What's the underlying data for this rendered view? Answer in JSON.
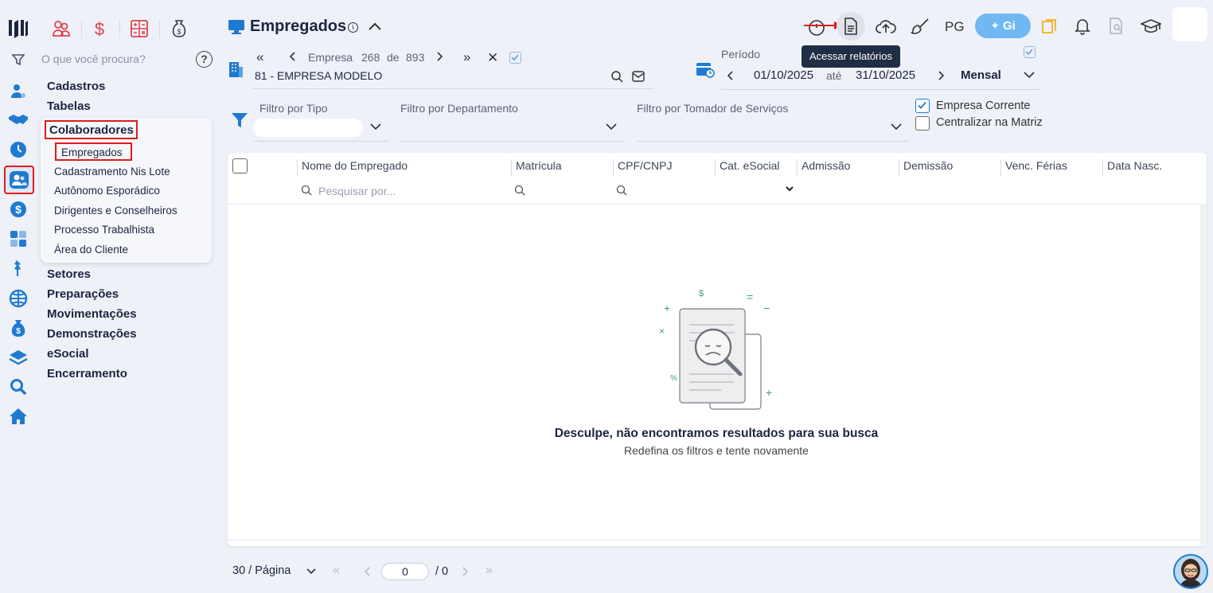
{
  "rail": {
    "icons": [
      "logo-icon",
      "filter-icon",
      "user-gear-icon",
      "handshake-icon",
      "clock-icon",
      "users-icon",
      "dollar-icon",
      "calculator-icon",
      "pin-icon",
      "globe-icon",
      "money-bag-icon",
      "layers-icon",
      "search-icon",
      "home-icon"
    ]
  },
  "quick_icons": {
    "colors": {
      "accent_red": "#e0424b"
    }
  },
  "search": {
    "placeholder": "O que você procura?",
    "help": "?"
  },
  "menu": {
    "items": [
      "Cadastros",
      "Tabelas",
      "Colaboradores",
      "Setores",
      "Preparações",
      "Movimentações",
      "Demonstrações",
      "eSocial",
      "Encerramento"
    ],
    "submenu": [
      "Empregados",
      "Cadastramento Nis Lote",
      "Autônomo Esporádico",
      "Dirigentes e Conselheiros",
      "Processo Trabalhista",
      "Área do Cliente"
    ]
  },
  "header": {
    "title": "Empregados",
    "tooltip": "Acessar relatórios",
    "pg_label": "PG",
    "gi_label": "Gi"
  },
  "company": {
    "nav_label": "Empresa",
    "index": "268",
    "of": "de",
    "total": "893",
    "name": "81 - EMPRESA MODELO"
  },
  "period": {
    "label": "Período",
    "start": "01/10/2025",
    "sep": "até",
    "end": "31/10/2025",
    "mode": "Mensal"
  },
  "filters": {
    "tipo": "Filtro por Tipo",
    "departamento": "Filtro por Departamento",
    "tomador": "Filtro por Tomador de Serviços",
    "empresa_corrente": "Empresa Corrente",
    "centralizar": "Centralizar na Matriz"
  },
  "table": {
    "columns": [
      "Nome do Empregado",
      "Matrícula",
      "CPF/CNPJ",
      "Cat. eSocial",
      "Admissão",
      "Demissão",
      "Venc. Férias",
      "Data Nasc."
    ],
    "search_placeholder": "Pesquisar por...",
    "empty_title": "Desculpe, não encontramos resultados para sua busca",
    "empty_subtitle": "Redefina os filtros e tente novamente"
  },
  "pagination": {
    "per_page": "30 / Página",
    "current": "0",
    "total": "/ 0"
  }
}
